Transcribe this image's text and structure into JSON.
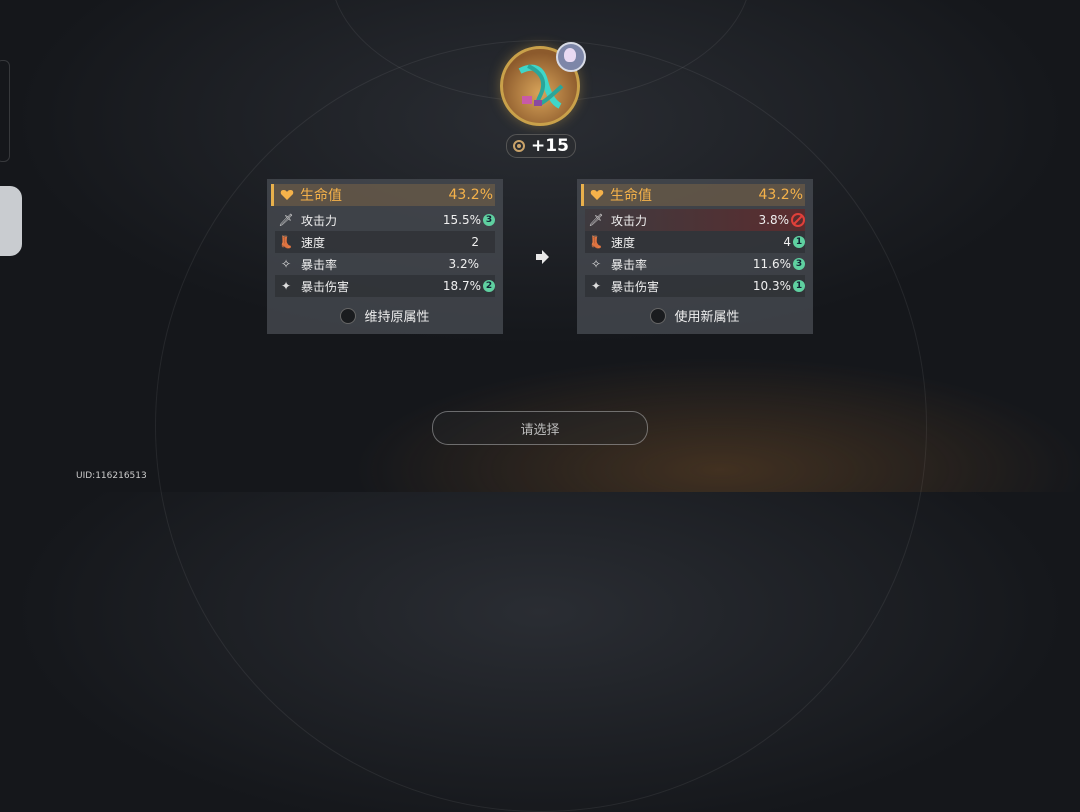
{
  "relic": {
    "level": "+15"
  },
  "left_panel": {
    "main": {
      "label": "生命值",
      "value": "43.2%"
    },
    "subs": [
      {
        "label": "攻击力",
        "value": "15.5%",
        "badge": "3"
      },
      {
        "label": "速度",
        "value": "2",
        "badge": ""
      },
      {
        "label": "暴击率",
        "value": "3.2%",
        "badge": ""
      },
      {
        "label": "暴击伤害",
        "value": "18.7%",
        "badge": "2"
      }
    ],
    "option_label": "维持原属性"
  },
  "right_panel": {
    "main": {
      "label": "生命值",
      "value": "43.2%"
    },
    "subs": [
      {
        "label": "攻击力",
        "value": "3.8%",
        "badge": ""
      },
      {
        "label": "速度",
        "value": "4",
        "badge": "1"
      },
      {
        "label": "暴击率",
        "value": "11.6%",
        "badge": "3"
      },
      {
        "label": "暴击伤害",
        "value": "10.3%",
        "badge": "1"
      }
    ],
    "option_label": "使用新属性"
  },
  "confirm_label": "请选择",
  "uid": "UID:116216513",
  "colors": {
    "main_stat": "#f5b24a",
    "badge": "#5fd0a0",
    "removed": "#e0403a"
  },
  "icons": [
    "heart-icon",
    "sword-icon",
    "boot-icon",
    "crit-rate-icon",
    "crit-dmg-icon",
    "arrow-right-icon",
    "no-entry-icon"
  ]
}
